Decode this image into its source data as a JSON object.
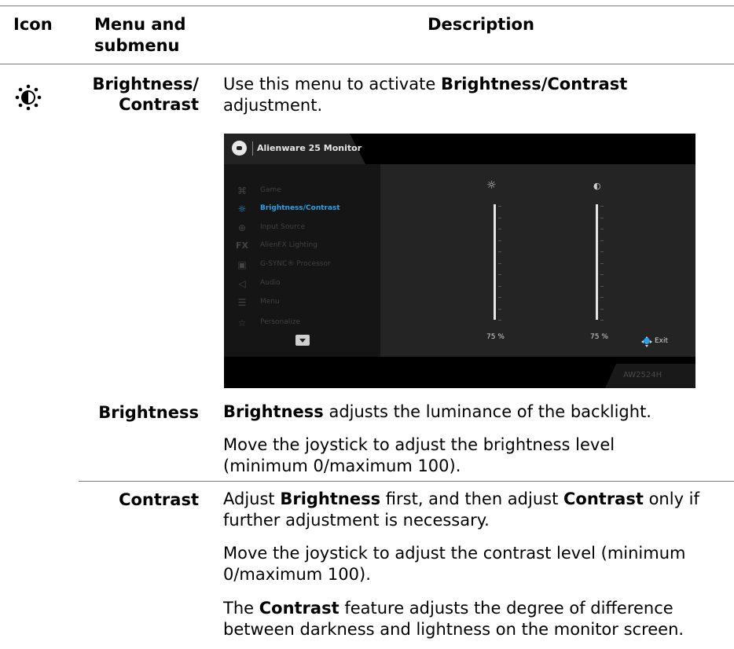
{
  "header": {
    "icon": "Icon",
    "menu_submenu": "Menu and submenu",
    "description": "Description"
  },
  "brightness_contrast": {
    "icon_name": "brightness-contrast-icon",
    "menu_label": "Brightness/ Contrast",
    "desc_pre": "Use this menu to activate ",
    "desc_bold": "Brightness/Contrast",
    "desc_post": " adjustment."
  },
  "osd": {
    "title": "Alienware 25 Monitor",
    "menu_items": [
      {
        "icon": "gamepad-icon",
        "label": "Game"
      },
      {
        "icon": "brightness-icon",
        "label": "Brightness/Contrast",
        "active": true
      },
      {
        "icon": "input-icon",
        "label": "Input Source"
      },
      {
        "icon": "fx-icon",
        "label": "AlienFX Lighting"
      },
      {
        "icon": "processor-icon",
        "label": "G-SYNC® Processor"
      },
      {
        "icon": "speaker-icon",
        "label": "Audio"
      },
      {
        "icon": "menu-icon",
        "label": "Menu"
      },
      {
        "icon": "star-icon",
        "label": "Personalize"
      }
    ],
    "brightness_value": "75 %",
    "contrast_value": "75 %",
    "brightness_level": 0.75,
    "contrast_level": 0.75,
    "exit_label": "Exit",
    "model": "AW2524H",
    "accent_color": "#2aa0e8"
  },
  "brightness": {
    "label": "Brightness",
    "p1_bold": "Brightness",
    "p1_rest": " adjusts the luminance of the backlight.",
    "p2_line1": "Move the joystick to adjust the brightness level",
    "p2_line2": "(minimum 0/maximum 100)."
  },
  "contrast": {
    "label": "Contrast",
    "p1_a": "Adjust ",
    "p1_b": "Brightness",
    "p1_c": " first, and then adjust ",
    "p1_d": "Contrast",
    "p1_e": " only if",
    "p1_line2": "further adjustment is necessary.",
    "p2_line1": "Move the joystick to adjust the contrast level (minimum",
    "p2_line2": "0/maximum 100).",
    "p3_a": "The ",
    "p3_b": "Contrast",
    "p3_c": " feature adjusts the degree of difference",
    "p3_line2": "between darkness and lightness on the monitor screen."
  }
}
